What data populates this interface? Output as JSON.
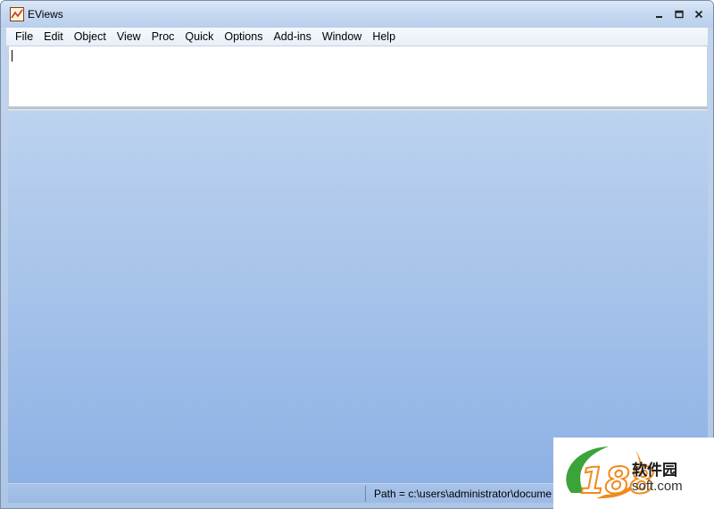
{
  "window": {
    "title": "EViews",
    "controls": {
      "minimize": "minimize",
      "maximize": "maximize",
      "close": "close"
    }
  },
  "menu": {
    "items": [
      "File",
      "Edit",
      "Object",
      "View",
      "Proc",
      "Quick",
      "Options",
      "Add-ins",
      "Window",
      "Help"
    ]
  },
  "command": {
    "value": ""
  },
  "status": {
    "path": "Path = c:\\users\\administrator\\docume"
  },
  "watermark": {
    "cn": "软件园",
    "en": "soft.com",
    "logo_text": "188"
  },
  "colors": {
    "workspace_top": "#bcd2ef",
    "workspace_bottom": "#8eb1e4",
    "accent_orange": "#f08a1c",
    "accent_green": "#3aa43a"
  },
  "icons": {
    "app": "eviews-chart-icon",
    "minimize": "minimize-icon",
    "maximize": "maximize-icon",
    "close": "close-icon"
  }
}
